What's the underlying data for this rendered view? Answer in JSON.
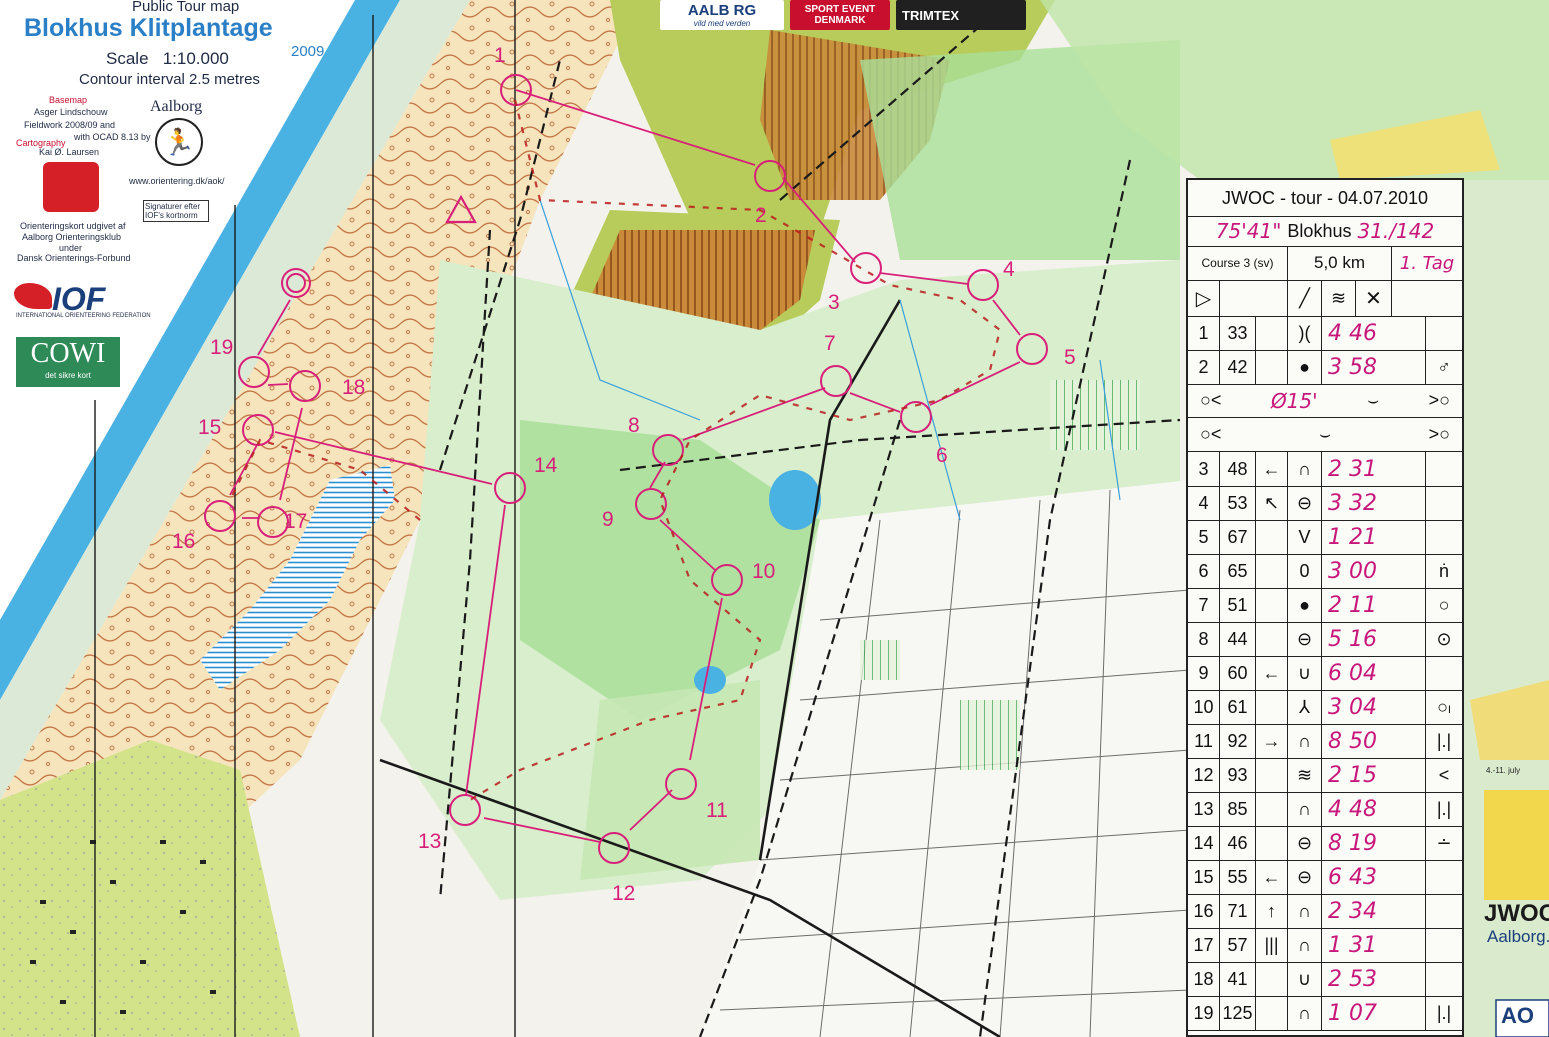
{
  "header": {
    "map_type": "Public Tour map",
    "title": "Blokhus Klitplantage",
    "scale": "Scale   1:10.000",
    "year": "2009",
    "contour": "Contour interval 2.5 metres",
    "basemap_label": "Basemap",
    "basemap_name": "Asger Lindschouw",
    "fieldwork": "Fieldwork  2008/09 and",
    "ocad": "with OCAD 8.13 by",
    "cartography": "Cartography",
    "cartographer": "Kai Ø. Laursen",
    "aalborg_club": "Aalborg",
    "club_url": "www.orientering.dk/aok/",
    "signatures": "Signaturer efter IOF's kortnorm",
    "publisher_1": "Orienteringskort udgivet af",
    "publisher_2": "Aalborg Orienteringsklub",
    "publisher_3": "under",
    "publisher_4": "Dansk Orienterings-Forbund",
    "iof": "IOF",
    "iof_full": "INTERNATIONAL ORIENTEERING FEDERATION",
    "cowi": "COWI",
    "cowi_tag": "det sikre kort"
  },
  "sponsors": [
    {
      "label": "AALB RG",
      "sub": "vild med verden",
      "bg": "#ffffff",
      "fg": "#1a3f7a"
    },
    {
      "label": "SPORT EVENT DENMARK",
      "bg": "#c8102e",
      "fg": "#ffffff"
    },
    {
      "label": "TRIMTEX",
      "bg": "#202020",
      "fg": "#ffffff"
    }
  ],
  "card": {
    "title": "JWOC - tour - 04.07.2010",
    "time_hand": "75'41\"",
    "location": "Blokhus",
    "rank_hand": "31./142",
    "course": "Course 3 (sv)",
    "length": "5,0 km",
    "day_hand": "1. Tag",
    "start_symbol": "▷",
    "interval_hand": "Ø15'",
    "rows": [
      {
        "n": "1",
        "code": "33",
        "dir": "",
        "feat": ")(",
        "split": "4 46",
        "ext": ""
      },
      {
        "n": "2",
        "code": "42",
        "dir": "",
        "feat": "●",
        "split": "3 58",
        "ext": "♂"
      },
      {
        "n": "3",
        "code": "48",
        "dir": "←",
        "feat": "∩",
        "split": "2 31",
        "ext": ""
      },
      {
        "n": "4",
        "code": "53",
        "dir": "↖",
        "feat": "⊖",
        "split": "3 32",
        "ext": ""
      },
      {
        "n": "5",
        "code": "67",
        "dir": "",
        "feat": "V",
        "split": "1 21",
        "ext": ""
      },
      {
        "n": "6",
        "code": "65",
        "dir": "",
        "feat": "0",
        "split": "3 00",
        "ext": "ṅ"
      },
      {
        "n": "7",
        "code": "51",
        "dir": "",
        "feat": "●",
        "split": "2 11",
        "ext": "○"
      },
      {
        "n": "8",
        "code": "44",
        "dir": "",
        "feat": "⊖",
        "split": "5 16",
        "ext": "⊙"
      },
      {
        "n": "9",
        "code": "60",
        "dir": "←",
        "feat": "∪",
        "split": "6 04",
        "ext": ""
      },
      {
        "n": "10",
        "code": "61",
        "dir": "",
        "feat": "⅄",
        "split": "3 04",
        "ext": "○ₗ"
      },
      {
        "n": "11",
        "code": "92",
        "dir": "→",
        "feat": "∩",
        "split": "8 50",
        "ext": "|.|"
      },
      {
        "n": "12",
        "code": "93",
        "dir": "",
        "feat": "≋",
        "split": "2 15",
        "ext": "<"
      },
      {
        "n": "13",
        "code": "85",
        "dir": "",
        "feat": "∩",
        "split": "4 48",
        "ext": "|.|"
      },
      {
        "n": "14",
        "code": "46",
        "dir": "",
        "feat": "⊖",
        "split": "8 19",
        "ext": "∸"
      },
      {
        "n": "15",
        "code": "55",
        "dir": "←",
        "feat": "⊖",
        "split": "6 43",
        "ext": ""
      },
      {
        "n": "16",
        "code": "71",
        "dir": "↑",
        "feat": "∩",
        "split": "2 34",
        "ext": ""
      },
      {
        "n": "17",
        "code": "57",
        "dir": "|||",
        "feat": "∩",
        "split": "1 31",
        "ext": ""
      },
      {
        "n": "18",
        "code": "41",
        "dir": "",
        "feat": "∪",
        "split": "2 53",
        "ext": ""
      },
      {
        "n": "19",
        "code": "125",
        "dir": "",
        "feat": "∩",
        "split": "1 07",
        "ext": "|.|"
      }
    ]
  },
  "controls": [
    {
      "n": "1"
    },
    {
      "n": "2"
    },
    {
      "n": "3"
    },
    {
      "n": "4"
    },
    {
      "n": "5"
    },
    {
      "n": "6"
    },
    {
      "n": "7"
    },
    {
      "n": "8"
    },
    {
      "n": "9"
    },
    {
      "n": "10"
    },
    {
      "n": "11"
    },
    {
      "n": "12"
    },
    {
      "n": "13"
    },
    {
      "n": "14"
    },
    {
      "n": "15"
    },
    {
      "n": "16"
    },
    {
      "n": "17"
    },
    {
      "n": "18"
    },
    {
      "n": "19"
    }
  ],
  "right_edge": {
    "jwoc": "JWOC",
    "place": "Aalborg.",
    "dates": "4.-11. july",
    "aoc": "AO"
  },
  "colors": {
    "course": "#d8207a",
    "forest_green": "#8ed18a",
    "dark_green": "#2f9a4c",
    "open_yellow": "#f1dc7a",
    "rough_open": "#f4e6b8",
    "contour": "#b8653a",
    "water": "#3a9fdc",
    "marsh": "#3a9fdc",
    "paper": "#f3f1ea"
  }
}
